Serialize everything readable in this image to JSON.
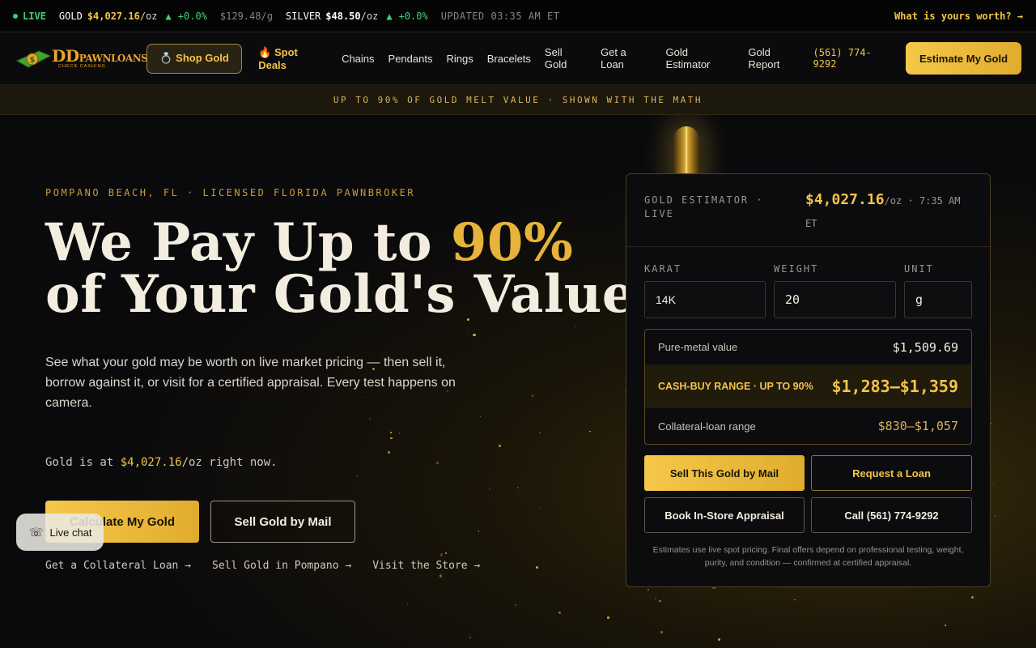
{
  "ticker": {
    "live": "LIVE",
    "gold_label": "GOLD",
    "gold_price": "$4,027.16",
    "gold_unit": "/oz",
    "gold_change": "+0.0%",
    "gold_per_gram": "$129.48/g",
    "silver_label": "SILVER",
    "silver_price": "$48.50",
    "silver_unit": "/oz",
    "silver_change": "+0.0%",
    "updated": "UPDATED 03:35 AM ET",
    "worth_link": "What is yours worth? →"
  },
  "nav": {
    "logo_big": "DD",
    "logo_word": "PAWNLOANS",
    "logo_small": "CHECK CASHING",
    "shop_gold": "💍 Shop Gold",
    "links": [
      "🔥 Spot Deals",
      "Chains",
      "Pendants",
      "Rings",
      "Bracelets",
      "Sell Gold",
      "Get a Loan",
      "Gold Estimator",
      "Gold Report"
    ],
    "phone": "(561) 774-9292",
    "estimate_btn": "Estimate My Gold"
  },
  "banner": "UP TO 90% OF GOLD MELT VALUE · SHOWN WITH THE MATH",
  "hero": {
    "eyebrow": "POMPANO BEACH, FL · LICENSED FLORIDA PAWNBROKER",
    "title_line1_a": "We Pay Up to ",
    "title_line1_b": "90%",
    "title_line2": "of Your Gold's Value.",
    "lede": "See what your gold may be worth on live market pricing — then sell it, borrow against it, or visit for a certified appraisal. Every test happens on camera.",
    "spot_prefix": "Gold is at ",
    "spot_price": "$4,027.16",
    "spot_suffix": "/oz right now.",
    "cta_primary": "Calculate My Gold",
    "cta_secondary": "Sell Gold by Mail",
    "sublinks": [
      "Get a Collateral Loan →",
      "Sell Gold in Pompano →",
      "Visit the Store →"
    ]
  },
  "live_chat": "Live chat",
  "estimator": {
    "label": "GOLD ESTIMATOR · LIVE",
    "price": "$4,027.16",
    "price_suffix": "/oz · 7:35 AM ET",
    "karat_label": "KARAT",
    "weight_label": "WEIGHT",
    "unit_label": "UNIT",
    "karat_value": "14K",
    "weight_value": "20",
    "unit_value": "g",
    "pure_label": "Pure-metal value",
    "pure_value": "$1,509.69",
    "cash_label": "CASH-BUY RANGE · UP TO 90%",
    "cash_value": "$1,283–$1,359",
    "loan_label": "Collateral-loan range",
    "loan_value": "$830–$1,057",
    "btn_sell_mail": "Sell This Gold by Mail",
    "btn_loan": "Request a Loan",
    "btn_appraisal": "Book In-Store Appraisal",
    "btn_call": "Call (561) 774-9292",
    "disclaimer": "Estimates use live spot pricing. Final offers depend on professional testing, weight, purity, and condition — confirmed at certified appraisal."
  }
}
